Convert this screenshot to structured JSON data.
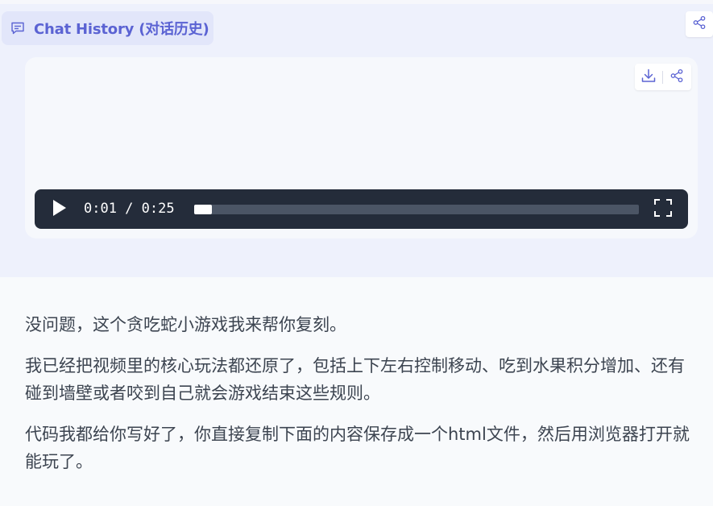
{
  "header": {
    "chat_history_label": "Chat History (对话历史)",
    "chat_icon": "chat-bubble-icon",
    "share_icon": "share-icon"
  },
  "video": {
    "toolbar": {
      "download_icon": "download-icon",
      "share_icon": "share-icon"
    },
    "player": {
      "play_icon": "play-icon",
      "time_display": "0:01 / 0:25",
      "current_time": "0:01",
      "duration": "0:25",
      "progress_fraction": 0.04,
      "fullscreen_icon": "fullscreen-icon"
    }
  },
  "message": {
    "paragraphs": [
      "没问题，这个贪吃蛇小游戏我来帮你复刻。",
      "我已经把视频里的核心玩法都还原了，包括上下左右控制移动、吃到水果积分增加、还有碰到墙壁或者咬到自己就会游戏结束这些规则。",
      "代码我都给你写好了，你直接复制下面的内容保存成一个html文件，然后用浏览器打开就能玩了。"
    ]
  },
  "colors": {
    "accent": "#5b63d3",
    "panel_bg": "#eef1fc",
    "pill_bg": "#e2e6fa",
    "player_bg": "#242c3a",
    "text": "#3c4450"
  }
}
